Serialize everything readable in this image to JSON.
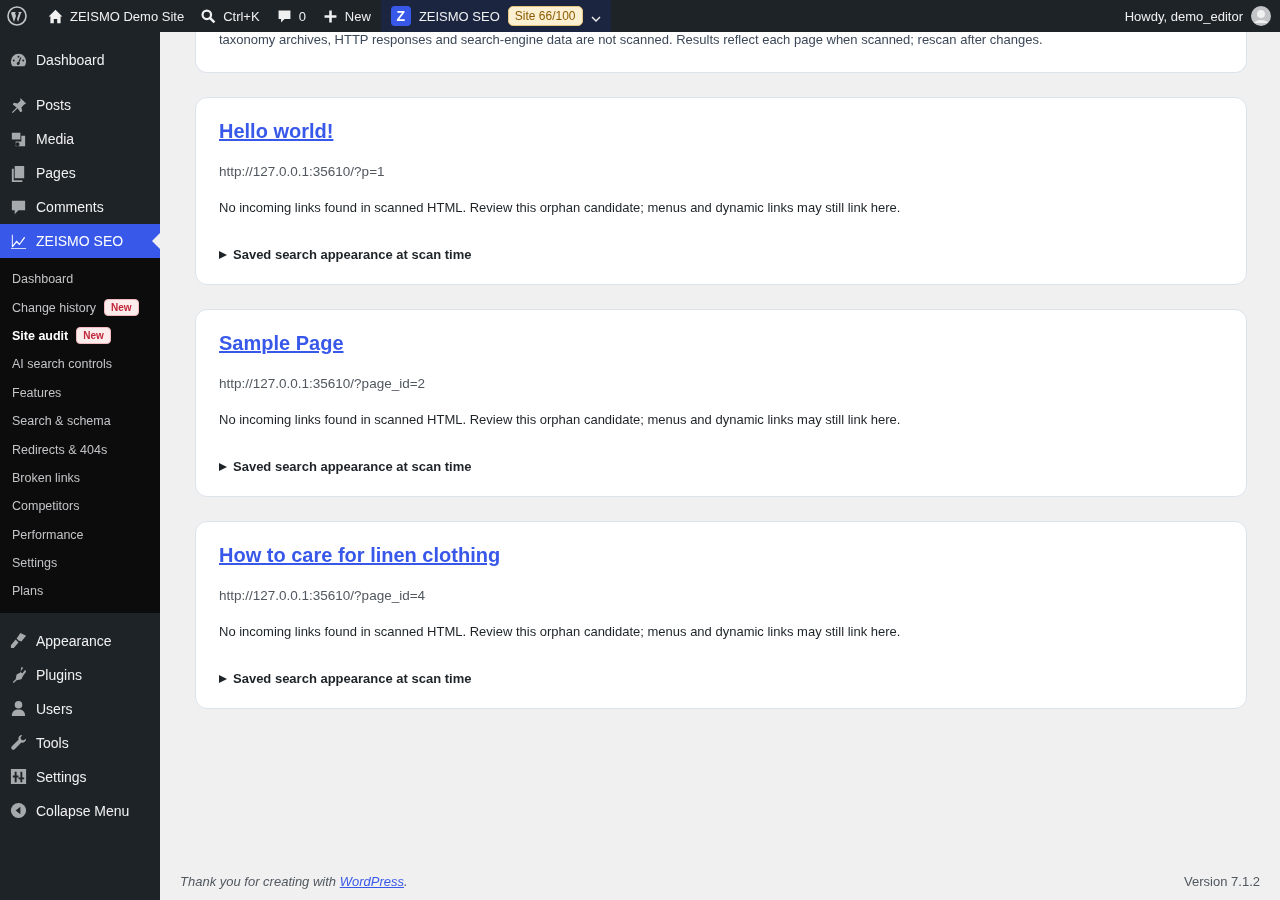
{
  "admin_bar": {
    "site": "ZEISMO Demo Site",
    "search": "Ctrl+K",
    "comments": "0",
    "new": "New",
    "plugin": {
      "logo": "Z",
      "name": "ZEISMO SEO",
      "badge": "Site 66/100"
    },
    "greeting": "Howdy, demo_editor"
  },
  "sidebar": {
    "items": [
      {
        "label": "Dashboard",
        "selected": false
      },
      {
        "label": "Posts",
        "selected": false
      },
      {
        "label": "Media",
        "selected": false
      },
      {
        "label": "Pages",
        "selected": false
      },
      {
        "label": "Comments",
        "selected": false
      },
      {
        "label": "ZEISMO SEO",
        "selected": true,
        "children": [
          {
            "label": "Dashboard",
            "selected": false
          },
          {
            "label": "Change history",
            "selected": false,
            "badge": "New"
          },
          {
            "label": "Site audit",
            "selected": true,
            "badge": "New"
          },
          {
            "label": "AI search controls",
            "selected": false
          },
          {
            "label": "Features",
            "selected": false
          },
          {
            "label": "Search & schema",
            "selected": false
          },
          {
            "label": "Redirects & 404s",
            "selected": false
          },
          {
            "label": "Broken links",
            "selected": false
          },
          {
            "label": "Competitors",
            "selected": false
          },
          {
            "label": "Performance",
            "selected": false
          },
          {
            "label": "Settings",
            "selected": false
          },
          {
            "label": "Plans",
            "selected": false
          }
        ]
      },
      {
        "label": "Appearance",
        "selected": false
      },
      {
        "label": "Plugins",
        "selected": false
      },
      {
        "label": "Users",
        "selected": false
      },
      {
        "label": "Tools",
        "selected": false
      },
      {
        "label": "Settings",
        "selected": false
      }
    ],
    "collapse": "Collapse Menu"
  },
  "intro": {
    "text": "taxonomy archives, HTTP responses and search-engine data are not scanned. Results reflect each page when scanned; rescan after changes."
  },
  "results": [
    {
      "title": "Hello world!",
      "url": "http://127.0.0.1:35610/?p=1",
      "message": "No incoming links found in scanned HTML. Review this orphan candidate; menus and dynamic links may still link here.",
      "summary": "Saved search appearance at scan time",
      "expanded": false
    },
    {
      "title": "Sample Page",
      "url": "http://127.0.0.1:35610/?page_id=2",
      "message": "No incoming links found in scanned HTML. Review this orphan candidate; menus and dynamic links may still link here.",
      "summary": "Saved search appearance at scan time",
      "expanded": false
    },
    {
      "title": "How to care for linen clothing",
      "url": "http://127.0.0.1:35610/?page_id=4",
      "message": "No incoming links found in scanned HTML. Review this orphan candidate; menus and dynamic links may still link here.",
      "summary": "Saved search appearance at scan time",
      "expanded": false
    }
  ],
  "footer": {
    "text": "Thank you for creating with ",
    "link": "WordPress",
    "after": ".",
    "version": "Version 7.1.2"
  }
}
